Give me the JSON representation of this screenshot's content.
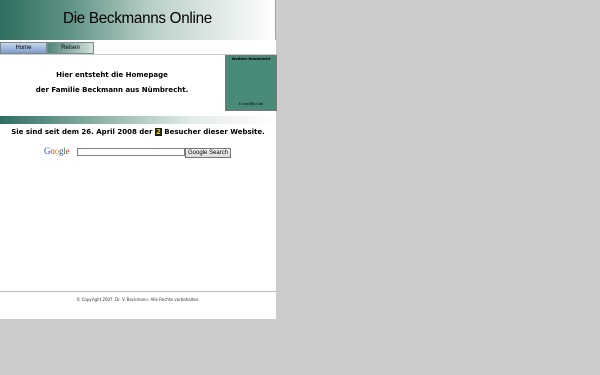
{
  "header": {
    "title": "Die Beckmanns Online"
  },
  "nav": {
    "tabs": [
      {
        "label": "Home"
      },
      {
        "label": "Reisen"
      }
    ]
  },
  "intro": {
    "line1": "Hier entsteht die Homepage",
    "line2": "der Familie Beckmann aus Nümbrecht."
  },
  "sidebox": {
    "name": "Walther Nümbrecht",
    "email": "E-mail@b3.de"
  },
  "visitor": {
    "prefix": "Sie sind seit dem 26. April 2008 der",
    "count": "2",
    "suffix": "Besucher dieser Website."
  },
  "search": {
    "logo": "Google",
    "input_value": "",
    "button_label": "Google Search"
  },
  "footer": {
    "copyright": "© Copyright 2007, Dr. V. Beckmann. Alle Rechte vorbehalten."
  },
  "colors": {
    "accent": "#2f6e60",
    "sidebox": "#4a8a78",
    "page_bg": "#cccccc",
    "counter_bg": "#1a1a1a",
    "counter_fg": "#f0d000"
  }
}
